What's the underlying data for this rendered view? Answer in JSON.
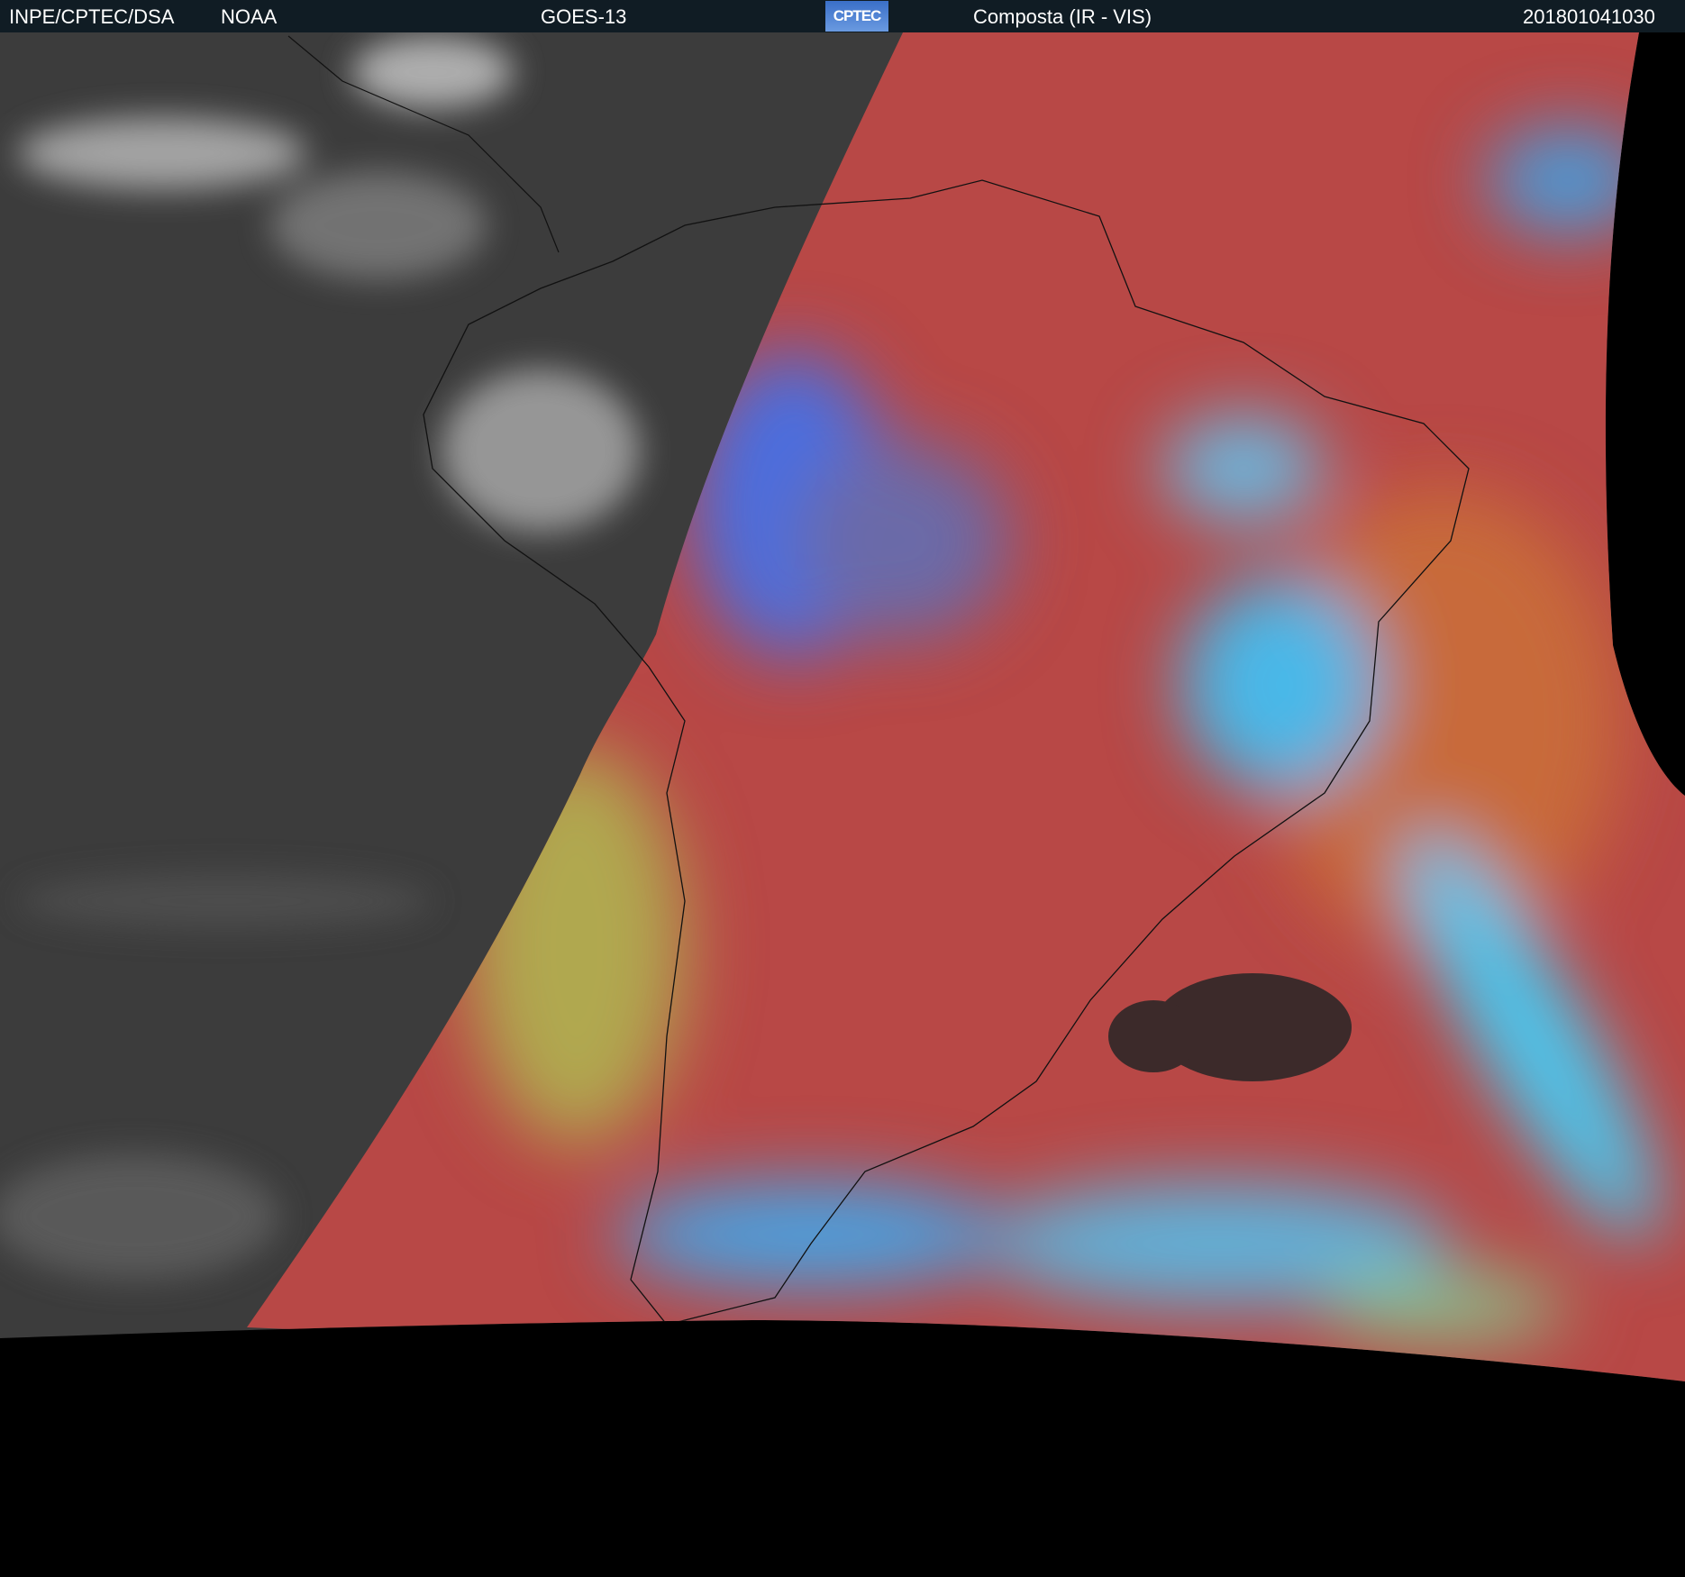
{
  "header": {
    "org": "INPE/CPTEC/DSA",
    "agency": "NOAA",
    "satellite": "GOES-13",
    "logo_text": "CPTEC",
    "product": "Composta (IR - VIS)",
    "timestamp": "201801041030"
  },
  "colors": {
    "bar": "#101c24",
    "ir_gray": "#3a3a3a",
    "vis_red": "#b84846",
    "cloud_blue": "#3aa8f0"
  }
}
